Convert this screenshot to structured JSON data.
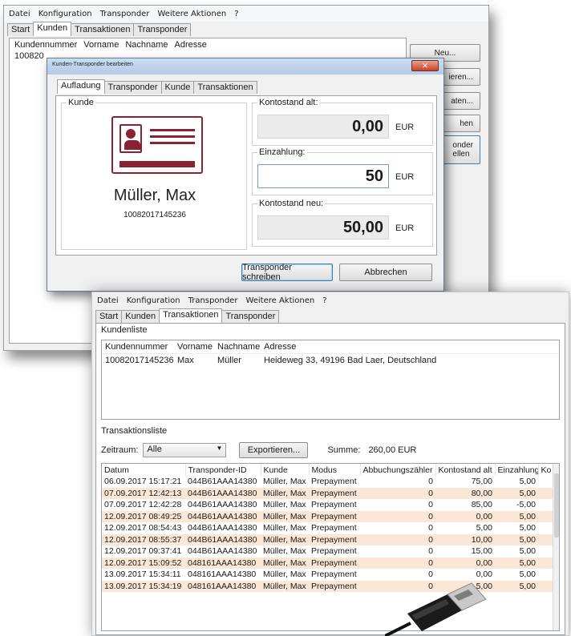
{
  "menu": [
    "Datei",
    "Konfiguration",
    "Transponder",
    "Weitere Aktionen",
    "?"
  ],
  "back_window": {
    "tabs": [
      "Start",
      "Kunden",
      "Transaktionen",
      "Transponder"
    ],
    "active_tab": "Kunden",
    "columns": [
      "Kundennummer",
      "Vorname",
      "Nachname",
      "Adresse"
    ],
    "first_row_partial": "100820",
    "side_buttons": [
      "Neu...",
      "ieren...",
      "aten...",
      "hen",
      "onder\nellen"
    ]
  },
  "dialog": {
    "title": "Kunden-Transponder bearbeiten",
    "close_glyph": "✕",
    "tabs": [
      "Aufladung",
      "Transponder",
      "Kunde",
      "Transaktionen"
    ],
    "kunde_legend": "Kunde",
    "customer_name": "Müller, Max",
    "customer_number": "10082017145236",
    "kontostand_alt_label": "Kontostand alt:",
    "kontostand_alt": "0,00",
    "einzahlung_label": "Einzahlung:",
    "einzahlung": "50",
    "kontostand_neu_label": "Kontostand neu:",
    "kontostand_neu": "50,00",
    "currency": "EUR",
    "write_button": "Transponder schreiben",
    "cancel_button": "Abbrechen"
  },
  "front_window": {
    "tabs": [
      "Start",
      "Kunden",
      "Transaktionen",
      "Transponder"
    ],
    "active_tab": "Transaktionen",
    "kundenliste_label": "Kundenliste",
    "customer_columns": [
      "Kundennummer",
      "Vorname",
      "Nachname",
      "Adresse"
    ],
    "customer_row": [
      "10082017145236",
      "Max",
      "Müller",
      "Heideweg 33, 49196 Bad Laer, Deutschland"
    ],
    "transaktionsliste_label": "Transaktionsliste",
    "zeitraum_label": "Zeitraum:",
    "zeitraum_value": "Alle",
    "export_button": "Exportieren...",
    "summe_label": "Summe:",
    "summe_value": "260,00 EUR",
    "tx_columns": [
      "Datum",
      "Transponder-ID",
      "Kunde",
      "Modus",
      "Abbuchungszähler",
      "Kontostand alt",
      "Einzahlung",
      "Ko"
    ],
    "transactions": [
      [
        "06.09.2017 15:17:21",
        "044B61AAA14380",
        "Müller, Max",
        "Prepayment",
        "0",
        "75,00",
        "5,00"
      ],
      [
        "07.09.2017 12:42:13",
        "044B61AAA14380",
        "Müller, Max",
        "Prepayment",
        "0",
        "80,00",
        "5,00"
      ],
      [
        "07.09.2017 12:42:28",
        "044B61AAA14380",
        "Müller, Max",
        "Prepayment",
        "0",
        "85,00",
        "-5,00"
      ],
      [
        "12.09.2017 08:49:25",
        "044B61AAA14380",
        "Müller, Max",
        "Prepayment",
        "0",
        "0,00",
        "5,00"
      ],
      [
        "12.09.2017 08:54:43",
        "044B61AAA14380",
        "Müller, Max",
        "Prepayment",
        "0",
        "5,00",
        "5,00"
      ],
      [
        "12.09.2017 08:55:37",
        "044B61AAA14380",
        "Müller, Max",
        "Prepayment",
        "0",
        "10,00",
        "5,00"
      ],
      [
        "12.09.2017 09:37:41",
        "044B61AAA14380",
        "Müller, Max",
        "Prepayment",
        "0",
        "15,00",
        "5,00"
      ],
      [
        "12.09.2017 15:09:52",
        "048161AAA14380",
        "Müller, Max",
        "Prepayment",
        "0",
        "0,00",
        "5,00"
      ],
      [
        "13.09.2017 15:34:11",
        "048161AAA14380",
        "Müller, Max",
        "Prepayment",
        "0",
        "0,00",
        "5,00"
      ],
      [
        "13.09.2017 15:34:19",
        "048161AAA14380",
        "Müller, Max",
        "Prepayment",
        "0",
        "5,00",
        "5,00"
      ]
    ]
  }
}
